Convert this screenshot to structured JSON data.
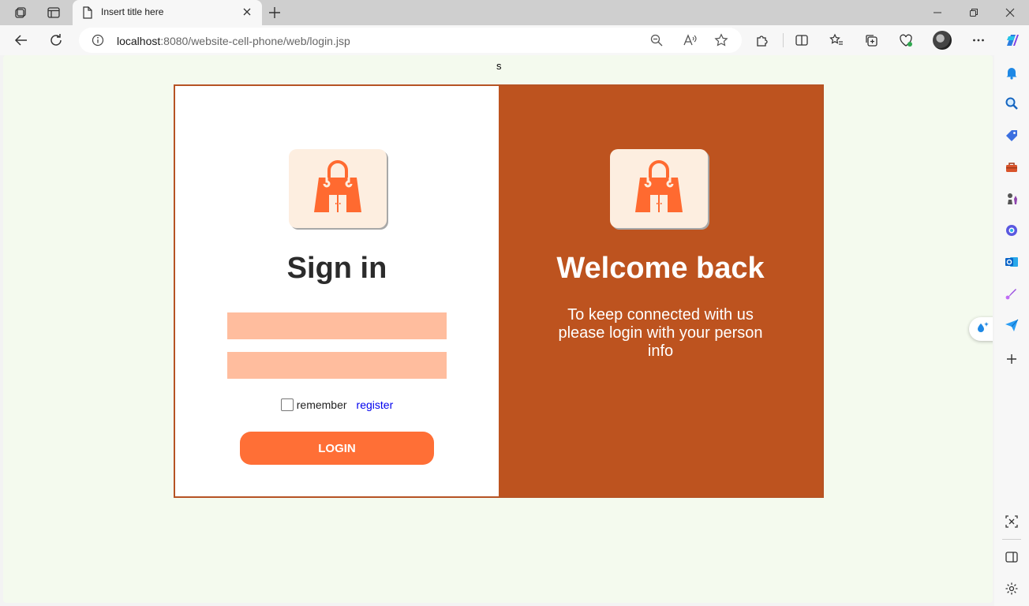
{
  "browser": {
    "tab": {
      "title": "Insert title here"
    },
    "address_bar": {
      "host": "localhost",
      "rest": ":8080/website-cell-phone/web/login.jsp"
    }
  },
  "page": {
    "stray_text": "s",
    "signin": {
      "title": "Sign in",
      "username_placeholder": "",
      "password_placeholder": "",
      "remember_label": "remember",
      "register_link": "register",
      "login_button": "LOGIN"
    },
    "welcome": {
      "title": "Welcome back",
      "message": "To keep connected with us please login with your person info"
    }
  },
  "icons": {
    "brand_logo": "shopping-bag-icon",
    "sidebar": [
      "bell-icon",
      "search-icon",
      "tag-icon",
      "toolbox-icon",
      "chess-icon",
      "copilot-icon",
      "outlook-icon",
      "designer-icon",
      "send-icon",
      "add-icon",
      "screenshot-icon",
      "sidebar-toggle-icon",
      "settings-icon"
    ]
  },
  "colors": {
    "page_background": "#f4faee",
    "panel_left": "#ffffff",
    "panel_right": "#bd531f",
    "field": "#ffbd9e",
    "button": "#ff6f36",
    "logo_bg": "#fdeee0",
    "logo_fg": "#ff6a30"
  }
}
